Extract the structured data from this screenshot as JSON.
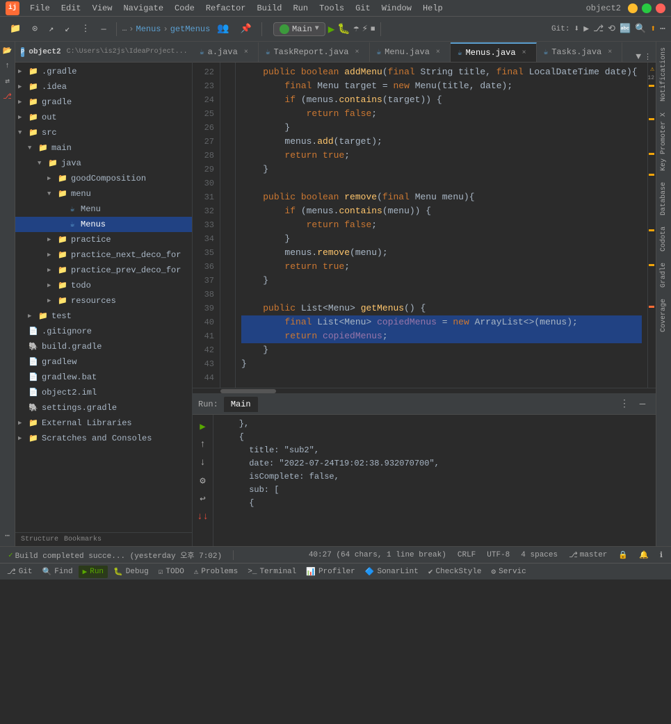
{
  "app": {
    "title": "object2",
    "logo": "ij"
  },
  "menubar": {
    "items": [
      "File",
      "Edit",
      "View",
      "Navigate",
      "Code",
      "Refactor",
      "Build",
      "Run",
      "Tools",
      "Git",
      "Window",
      "Help"
    ]
  },
  "toolbar": {
    "breadcrumbs": [
      "Menus",
      "getMenus"
    ],
    "run_config": "Main",
    "git_label": "Git:"
  },
  "tabs": [
    {
      "label": "a.java",
      "icon": "☕",
      "active": false,
      "closable": true
    },
    {
      "label": "TaskReport.java",
      "icon": "☕",
      "active": false,
      "closable": true
    },
    {
      "label": "Menu.java",
      "icon": "☕",
      "active": false,
      "closable": true
    },
    {
      "label": "Menus.java",
      "icon": "☕",
      "active": true,
      "closable": true
    },
    {
      "label": "Tasks.java",
      "icon": "☕",
      "active": false,
      "closable": true
    }
  ],
  "sidebar": {
    "project_label": "object2",
    "project_path": "C:\\Users\\is2js\\IdeaProject...",
    "items": [
      {
        "label": ".gradle",
        "type": "folder",
        "indent": 0,
        "open": false
      },
      {
        "label": ".idea",
        "type": "folder",
        "indent": 0,
        "open": false
      },
      {
        "label": "gradle",
        "type": "folder",
        "indent": 0,
        "open": false
      },
      {
        "label": "out",
        "type": "folder",
        "indent": 0,
        "open": false,
        "selected": true
      },
      {
        "label": "src",
        "type": "folder",
        "indent": 0,
        "open": true
      },
      {
        "label": "main",
        "type": "folder",
        "indent": 1,
        "open": true
      },
      {
        "label": "java",
        "type": "folder",
        "indent": 2,
        "open": true
      },
      {
        "label": "goodComposition",
        "type": "folder",
        "indent": 3,
        "open": false
      },
      {
        "label": "menu",
        "type": "folder",
        "indent": 3,
        "open": true
      },
      {
        "label": "Menu",
        "type": "class",
        "indent": 4,
        "open": false
      },
      {
        "label": "Menus",
        "type": "class",
        "indent": 4,
        "open": false,
        "active": true
      },
      {
        "label": "practice",
        "type": "folder",
        "indent": 3,
        "open": false
      },
      {
        "label": "practice_next_deco_for",
        "type": "folder",
        "indent": 3,
        "open": false
      },
      {
        "label": "practice_prev_deco_for",
        "type": "folder",
        "indent": 3,
        "open": false
      },
      {
        "label": "todo",
        "type": "folder",
        "indent": 3,
        "open": false
      },
      {
        "label": "resources",
        "type": "folder",
        "indent": 3,
        "open": false
      },
      {
        "label": "test",
        "type": "folder",
        "indent": 1,
        "open": false
      },
      {
        "label": ".gitignore",
        "type": "text",
        "indent": 0,
        "open": false
      },
      {
        "label": "build.gradle",
        "type": "gradle",
        "indent": 0,
        "open": false
      },
      {
        "label": "gradlew",
        "type": "text",
        "indent": 0,
        "open": false
      },
      {
        "label": "gradlew.bat",
        "type": "text",
        "indent": 0,
        "open": false
      },
      {
        "label": "object2.iml",
        "type": "text",
        "indent": 0,
        "open": false
      },
      {
        "label": "settings.gradle",
        "type": "gradle",
        "indent": 0,
        "open": false
      },
      {
        "label": "External Libraries",
        "type": "folder",
        "indent": 0,
        "open": false
      },
      {
        "label": "Scratches and Consoles",
        "type": "folder",
        "indent": 0,
        "open": false
      }
    ],
    "footer_items": [
      "Structure",
      "Bookmarks"
    ]
  },
  "editor": {
    "warning_count": 12,
    "lines": [
      {
        "num": 22,
        "text": "    public boolean addMenu(final String title, final LocalDateTime date){",
        "highlight": false
      },
      {
        "num": 23,
        "text": "        final Menu target = new Menu(title, date);",
        "highlight": false
      },
      {
        "num": 24,
        "text": "        if (menus.contains(target)) {",
        "highlight": false
      },
      {
        "num": 25,
        "text": "            return false;",
        "highlight": false
      },
      {
        "num": 26,
        "text": "        }",
        "highlight": false
      },
      {
        "num": 27,
        "text": "        menus.add(target);",
        "highlight": false
      },
      {
        "num": 28,
        "text": "        return true;",
        "highlight": false
      },
      {
        "num": 29,
        "text": "    }",
        "highlight": false
      },
      {
        "num": 30,
        "text": "",
        "highlight": false
      },
      {
        "num": 31,
        "text": "    public boolean remove(final Menu menu){",
        "highlight": false
      },
      {
        "num": 32,
        "text": "        if (menus.contains(menu)) {",
        "highlight": false
      },
      {
        "num": 33,
        "text": "            return false;",
        "highlight": false
      },
      {
        "num": 34,
        "text": "        }",
        "highlight": false
      },
      {
        "num": 35,
        "text": "        menus.remove(menu);",
        "highlight": false
      },
      {
        "num": 36,
        "text": "        return true;",
        "highlight": false
      },
      {
        "num": 37,
        "text": "    }",
        "highlight": false
      },
      {
        "num": 38,
        "text": "",
        "highlight": false
      },
      {
        "num": 39,
        "text": "    public List<Menu> getMenus() {",
        "highlight": false
      },
      {
        "num": 40,
        "text": "        final List<Menu> copiedMenus = new ArrayList<>(menus);",
        "highlight": true
      },
      {
        "num": 41,
        "text": "        return copiedMenus;",
        "highlight": true
      },
      {
        "num": 42,
        "text": "    }",
        "highlight": false
      },
      {
        "num": 43,
        "text": "}",
        "highlight": false
      },
      {
        "num": 44,
        "text": "",
        "highlight": false
      }
    ]
  },
  "bottom_panel": {
    "run_label": "Run:",
    "config_label": "Main",
    "output_lines": [
      "    },",
      "    {",
      "      title: \"sub2\",",
      "      date: \"2022-07-24T19:02:38.932070700\",",
      "      isComplete: false,",
      "      sub: [",
      "      {"
    ]
  },
  "right_tabs": [
    "Notifications",
    "Key Promoter X",
    "Database",
    "Codota",
    "Gradle",
    "Coverage"
  ],
  "status_bar": {
    "build_message": "Build completed succe... (yesterday 오후 7:02)",
    "position": "40:27 (64 chars, 1 line break)",
    "line_ending": "CRLF",
    "encoding": "UTF-8",
    "indent": "4 spaces",
    "vcs": "master",
    "items": [
      "Git",
      "Find",
      "Run",
      "Debug",
      "TODO",
      "Problems",
      "Terminal",
      "Profiler",
      "SonarLint",
      "CheckStyle",
      "Servic"
    ]
  }
}
